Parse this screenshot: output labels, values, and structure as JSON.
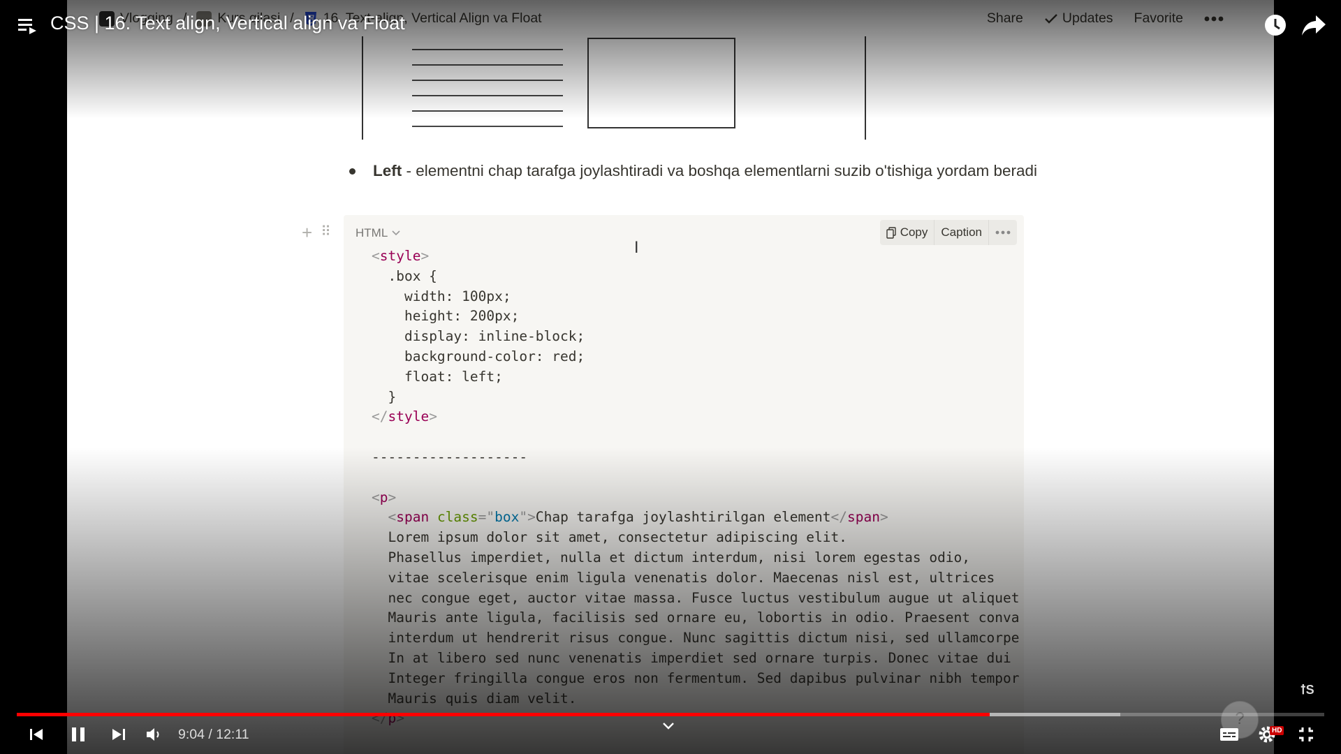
{
  "player": {
    "title": "CSS | 16. Text align, Vertical align va Float",
    "time_current": "9:04",
    "time_separator": " / ",
    "time_total": "12:11",
    "progress_fraction": 0.744,
    "buffered_fraction": 0.844,
    "accent_color": "#ff0000",
    "hd_label": "HD",
    "help_label": "?",
    "watermark": "ꝉS"
  },
  "notion": {
    "breadcrumbs": [
      "Vlogging",
      "Kurs qilasi",
      "16. Text-align, Vertical Align va Float"
    ],
    "breadcrumb_sep": "/",
    "actions": {
      "share": "Share",
      "updates": "Updates",
      "favorite": "Favorite"
    }
  },
  "content": {
    "bullet_bold": "Left",
    "bullet_text": " - elementni chap tarafga joylashtiradi va boshqa elementlarni suzib o'tishiga yordam beradi",
    "code_language": "HTML",
    "copy_label": "Copy",
    "caption_label": "Caption",
    "code": {
      "style_open": "style",
      "selector": ".box {",
      "props": [
        "width: 100px;",
        "height: 200px;",
        "display: inline-block;",
        "background-color: red;",
        "float: left;"
      ],
      "close_brace": "}",
      "style_close": "style",
      "divider": "-------------------",
      "p_tag": "p",
      "span_tag": "span",
      "span_attr": "class",
      "span_attr_value": "box",
      "span_text": "Chap tarafga joylashtirilgan element",
      "lorem": [
        "Lorem ipsum dolor sit amet, consectetur adipiscing elit.",
        "Phasellus imperdiet, nulla et dictum interdum, nisi lorem egestas odio,",
        "vitae scelerisque enim ligula venenatis dolor. Maecenas nisl est, ultrices",
        "nec congue eget, auctor vitae massa. Fusce luctus vestibulum augue ut aliquet",
        "Mauris ante ligula, facilisis sed ornare eu, lobortis in odio. Praesent conva",
        "interdum ut hendrerit risus congue. Nunc sagittis dictum nisi, sed ullamcorpe",
        "In at libero sed nunc venenatis imperdiet sed ornare turpis. Donec vitae dui",
        "Integer fringilla congue eros non fermentum. Sed dapibus pulvinar nibh tempor",
        "Mauris quis diam velit."
      ]
    }
  }
}
